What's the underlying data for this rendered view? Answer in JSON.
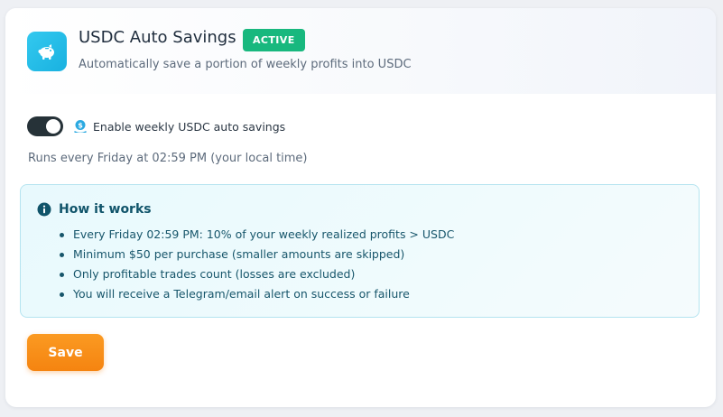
{
  "header": {
    "icon": "piggy-bank-icon",
    "title": "USDC Auto Savings",
    "status_badge": "ACTIVE",
    "subtitle": "Automatically save a portion of weekly profits into USDC"
  },
  "toggle": {
    "enabled": true,
    "icon": "coin-icon",
    "label": "Enable weekly USDC auto savings"
  },
  "schedule_text": "Runs every Friday at 02:59 PM (your local time)",
  "how_it_works": {
    "icon": "info-icon",
    "title": "How it works",
    "items": [
      "Every Friday 02:59 PM: 10% of your weekly realized profits  >  USDC",
      "Minimum $50 per purchase (smaller amounts are skipped)",
      "Only profitable trades count (losses are excluded)",
      "You will receive a Telegram/email alert on success or failure"
    ]
  },
  "actions": {
    "save_label": "Save"
  },
  "colors": {
    "brand_cyan": "#1fb8e6",
    "badge_green": "#18b87e",
    "accent_orange": "#f58410",
    "info_bg": "#e8f9fd",
    "info_text": "#10546a"
  }
}
